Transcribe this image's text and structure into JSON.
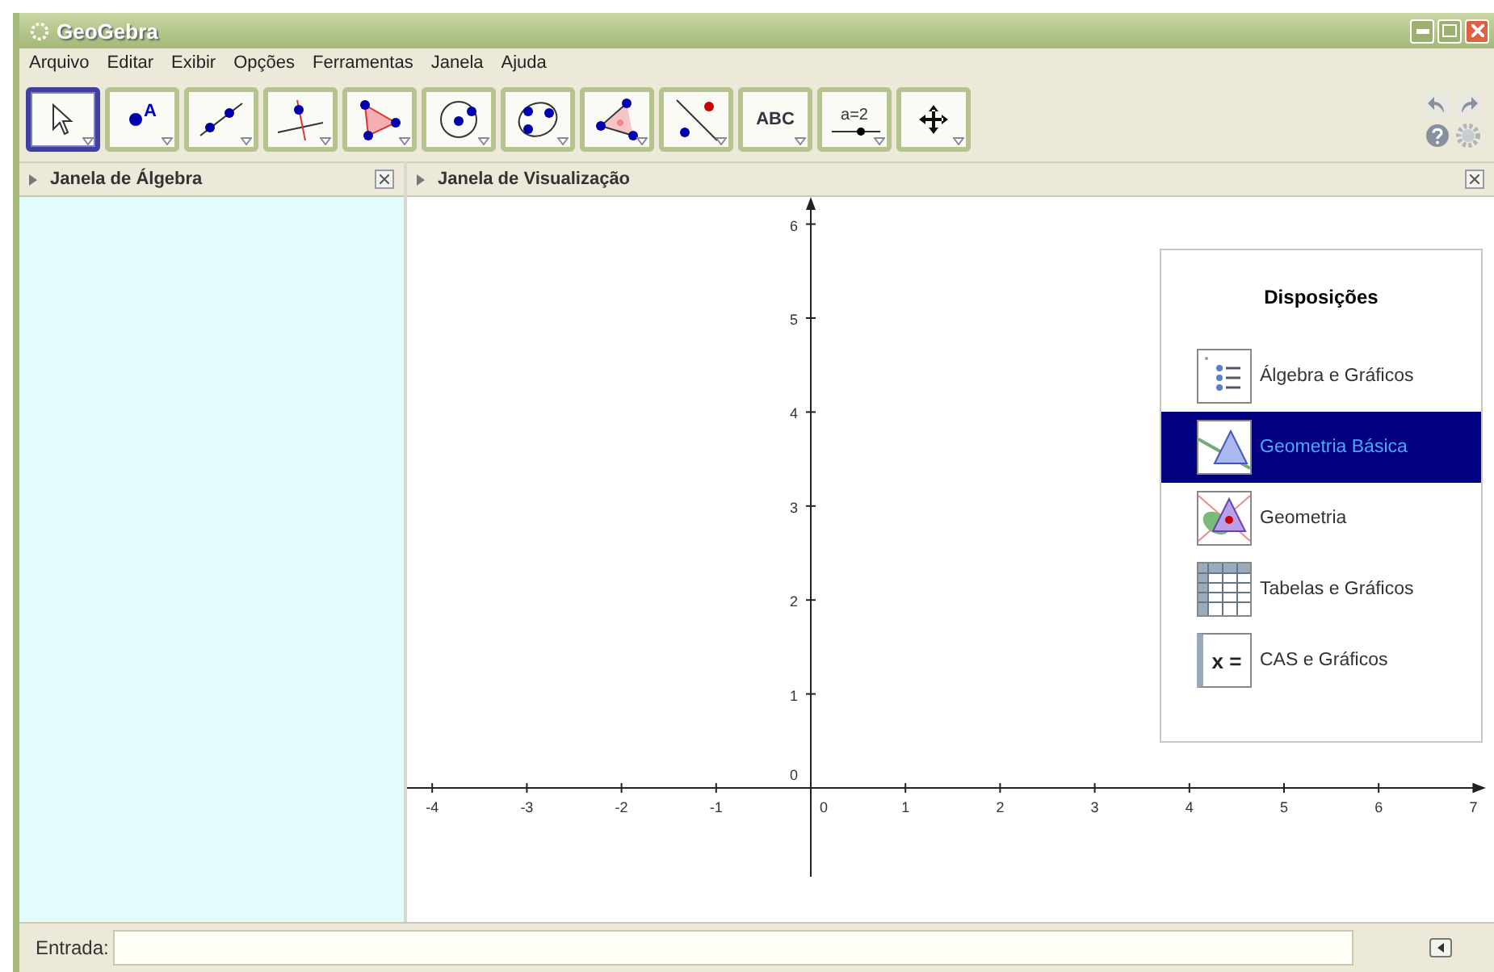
{
  "window": {
    "title": "GeoGebra"
  },
  "menu": [
    "Arquivo",
    "Editar",
    "Exibir",
    "Opções",
    "Ferramentas",
    "Janela",
    "Ajuda"
  ],
  "tools": [
    {
      "kind": "move",
      "selected": true
    },
    {
      "kind": "point",
      "label": "A",
      "selected": false
    },
    {
      "kind": "line",
      "selected": false
    },
    {
      "kind": "perpendicular",
      "selected": false
    },
    {
      "kind": "polygon",
      "selected": false
    },
    {
      "kind": "circle",
      "selected": false
    },
    {
      "kind": "conic",
      "selected": false
    },
    {
      "kind": "angle",
      "selected": false
    },
    {
      "kind": "reflect",
      "selected": false
    },
    {
      "kind": "text",
      "label": "ABC",
      "selected": false
    },
    {
      "kind": "slider",
      "label": "a=2",
      "selected": false
    },
    {
      "kind": "pan",
      "selected": false
    }
  ],
  "algebra_panel": {
    "title": "Janela de Álgebra"
  },
  "graphics_panel": {
    "title": "Janela de Visualização",
    "x_ticks": [
      "-4",
      "-3",
      "-2",
      "-1",
      "0",
      "1",
      "2",
      "3",
      "4",
      "5",
      "6",
      "7"
    ],
    "y_ticks": [
      "6",
      "5",
      "4",
      "3",
      "2",
      "1",
      "0"
    ]
  },
  "layouts": {
    "title": "Disposições",
    "items": [
      {
        "kind": "algebra",
        "label": "Álgebra e Gráficos",
        "selected": false
      },
      {
        "kind": "basic",
        "label": "Geometria Básica",
        "selected": true
      },
      {
        "kind": "geometry",
        "label": "Geometria",
        "selected": false
      },
      {
        "kind": "spreadsheet",
        "label": "Tabelas e Gráficos",
        "selected": false
      },
      {
        "kind": "cas",
        "icon_text": "x =",
        "label": "CAS e Gráficos",
        "selected": false
      }
    ]
  },
  "input_bar": {
    "label": "Entrada:"
  }
}
